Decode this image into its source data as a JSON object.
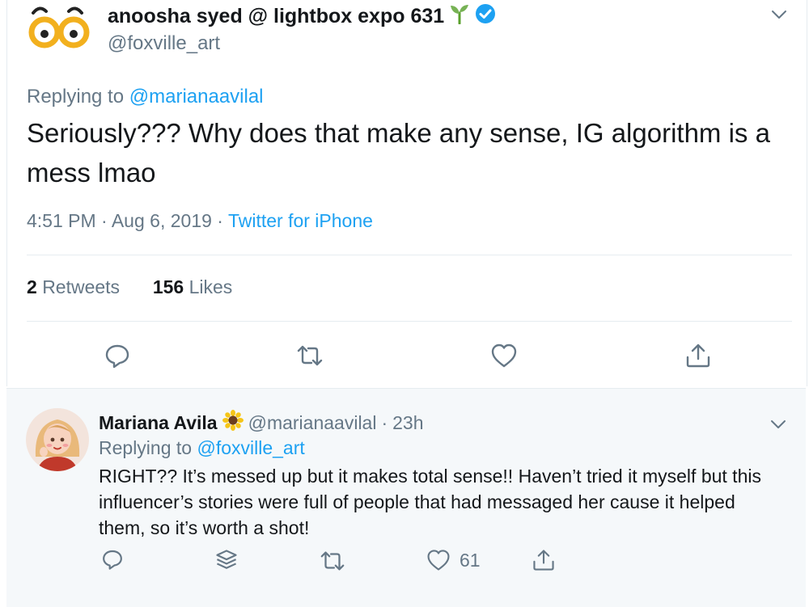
{
  "main_tweet": {
    "display_name": "anoosha syed @ lightbox expo 631",
    "handle": "@foxville_art",
    "replying_prefix": "Replying to",
    "replying_to": "@marianaavilal",
    "text": "Seriously??? Why does that make any sense, IG algorithm is a mess lmao",
    "time": "4:51 PM",
    "date": "Aug 6, 2019",
    "separator": "·",
    "source": "Twitter for iPhone",
    "retweets_count": "2",
    "retweets_label": "Retweets",
    "likes_count": "156",
    "likes_label": "Likes",
    "icons": {
      "avatar": "cartoon-eyes-avatar",
      "emoji": "seedling-emoji",
      "verified": "verified-badge-icon",
      "menu": "chevron-down-icon",
      "actions": [
        "reply-icon",
        "retweet-icon",
        "like-icon",
        "share-icon"
      ]
    }
  },
  "reply_tweet": {
    "display_name": "Mariana Avila",
    "handle": "@marianaavilal",
    "time_ago": "23h",
    "separator": "·",
    "replying_prefix": "Replying to",
    "replying_to": "@foxville_art",
    "text": "RIGHT?? It’s messed up but it makes total sense!! Haven’t tried it myself but this influencer’s stories were full of people that had messaged her cause it helped them, so it’s worth a shot!",
    "like_count": "61",
    "icons": {
      "avatar": "illustrated-girl-avatar",
      "emoji": "sunflower-emoji",
      "menu": "chevron-down-icon",
      "actions": [
        "reply-icon",
        "thread-icon",
        "retweet-icon",
        "like-icon",
        "share-icon"
      ]
    }
  },
  "colors": {
    "link": "#1da1f2",
    "secondary_text": "#657786",
    "primary_text": "#14171a",
    "reply_background": "#f5f8fa",
    "divider": "#e6ecf0"
  }
}
